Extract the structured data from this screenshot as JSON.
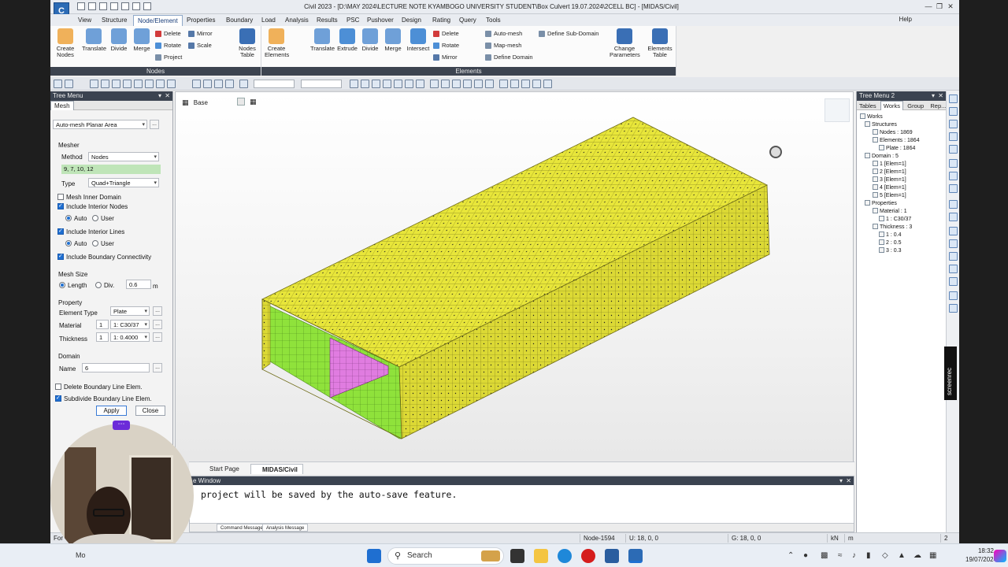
{
  "app": {
    "logo": "C",
    "title": "Civil 2023 - [D:\\MAY 2024\\LECTURE NOTE KYAMBOGO UNIVERSITY STUDENT\\Box Culvert 19.07.2024\\2CELL BC] - [MIDAS/Civil]",
    "help": "Help"
  },
  "menu": {
    "tabs": [
      "View",
      "Structure",
      "Node/Element",
      "Properties",
      "Boundary",
      "Load",
      "Analysis",
      "Results",
      "PSC",
      "Pushover",
      "Design",
      "Rating",
      "Query",
      "Tools"
    ],
    "active": "Node/Element"
  },
  "ribbon": {
    "nodes_group": "Nodes",
    "elements_group": "Elements",
    "create_nodes": "Create Nodes",
    "translate": "Translate",
    "divide": "Divide",
    "merge": "Merge",
    "delete": "Delete",
    "rotate": "Rotate",
    "project": "Project",
    "mirror": "Mirror",
    "scale": "Scale",
    "nodes_table": "Nodes Table",
    "create_elements": "Create Elements",
    "extrude": "Extrude",
    "intersect": "Intersect",
    "auto_mesh": "Auto-mesh",
    "map_mesh": "Map-mesh",
    "define_domain": "Define Domain",
    "define_sub_domain": "Define Sub-Domain",
    "change_parameters": "Change Parameters",
    "elements_table": "Elements Table"
  },
  "left_panel": {
    "header": "Tree Menu",
    "tab": "Mesh",
    "mode": "Auto-mesh Planar Area",
    "mesher_label": "Mesher",
    "method_label": "Method",
    "method_value": "Nodes",
    "node_list": "9, 7, 10, 12",
    "type_label": "Type",
    "type_value": "Quad+Triangle",
    "mesh_inner_domain": "Mesh Inner Domain",
    "include_interior_nodes": "Include Interior Nodes",
    "auto": "Auto",
    "user": "User",
    "include_interior_lines": "Include Interior Lines",
    "include_boundary_connectivity": "Include Boundary Connectivity",
    "mesh_size_label": "Mesh Size",
    "length": "Length",
    "div": "Div.",
    "size_value": "0.6",
    "unit_m": "m",
    "property_label": "Property",
    "element_type_label": "Element Type",
    "element_type_value": "Plate",
    "material_label": "Material",
    "material_num": "1",
    "material_value": "1: C30/37",
    "thickness_label": "Thickness",
    "thickness_num": "1",
    "thickness_value": "1: 0.4000",
    "domain_label": "Domain",
    "name_label": "Name",
    "name_value": "6",
    "delete_boundary": "Delete Boundary Line Elem.",
    "subdivide_boundary": "Subdivide Boundary Line Elem.",
    "apply": "Apply",
    "close": "Close",
    "ellipsis": "..."
  },
  "viewport": {
    "view_name": "Base"
  },
  "doc_tabs": [
    "Start Page",
    "MIDAS/Civil"
  ],
  "message_window": {
    "header": "e Window",
    "text": "project will be saved by the auto-save feature.",
    "tabs": [
      "Command Message",
      "Analysis Message"
    ]
  },
  "status": {
    "left": "For",
    "node": "Node-1594",
    "u": "U: 18, 0, 0",
    "g": "G: 18, 0, 0",
    "unit1": "kN",
    "unit2": "m",
    "page": "2"
  },
  "right_panel": {
    "header": "Tree Menu 2",
    "tabs": [
      "Tables",
      "Works",
      "Group",
      "Rep..."
    ],
    "active_tab": "Works",
    "tree": [
      {
        "level": 0,
        "text": "Works"
      },
      {
        "level": 1,
        "text": "Structures"
      },
      {
        "level": 2,
        "text": "Nodes : 1869"
      },
      {
        "level": 2,
        "text": "Elements : 1864"
      },
      {
        "level": 3,
        "text": "Plate : 1864"
      },
      {
        "level": 1,
        "text": "Domain : 5"
      },
      {
        "level": 2,
        "text": "1 [Elem=1]"
      },
      {
        "level": 2,
        "text": "2 [Elem=1]"
      },
      {
        "level": 2,
        "text": "3 [Elem=1]"
      },
      {
        "level": 2,
        "text": "4 [Elem=1]"
      },
      {
        "level": 2,
        "text": "5 [Elem=1]"
      },
      {
        "level": 1,
        "text": "Properties"
      },
      {
        "level": 2,
        "text": "Material : 1"
      },
      {
        "level": 3,
        "text": "1 : C30/37"
      },
      {
        "level": 2,
        "text": "Thickness : 3"
      },
      {
        "level": 3,
        "text": "1 : 0.4"
      },
      {
        "level": 3,
        "text": "2 : 0.5"
      },
      {
        "level": 3,
        "text": "3 : 0.3"
      }
    ]
  },
  "screenrec": "screenrec",
  "taskbar": {
    "search": "Search",
    "time": "18:32",
    "date": "19/07/2024",
    "left_text": "Mo"
  },
  "colors": {
    "mesh_yellow": "#e8e63a",
    "mesh_green": "#8fe23b",
    "mesh_magenta": "#e07ce0",
    "panel_dark": "#3b4350"
  }
}
